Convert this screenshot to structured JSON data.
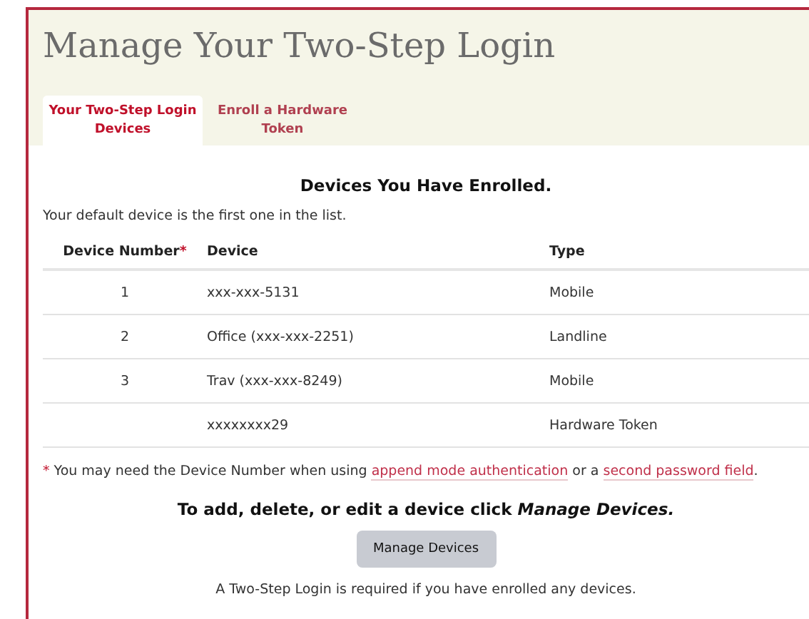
{
  "page": {
    "title": "Manage Your Two-Step Login"
  },
  "tabs": [
    {
      "label": "Your Two-Step Login Devices",
      "selected": true
    },
    {
      "label": "Enroll a Hardware Token",
      "selected": false
    }
  ],
  "heading": "Devices You Have Enrolled.",
  "intro": "Your default device is the first one in the list.",
  "table": {
    "columns": [
      {
        "label": "Device Number",
        "mark": "*"
      },
      {
        "label": "Device"
      },
      {
        "label": "Type"
      }
    ],
    "rows": [
      [
        "1",
        "xxx-xxx-5131",
        "Mobile"
      ],
      [
        "2",
        "Office (xxx-xxx-2251)",
        "Landline"
      ],
      [
        "3",
        "Trav (xxx-xxx-8249)",
        "Mobile"
      ],
      [
        "",
        "xxxxxxxx29",
        "Hardware Token"
      ]
    ]
  },
  "footnote": {
    "mark": "*",
    "parts": [
      {
        "kind": "text",
        "text": "You may need the Device Number when using "
      },
      {
        "kind": "link",
        "text": "append mode authentication"
      },
      {
        "kind": "text",
        "text": " or a "
      },
      {
        "kind": "link",
        "text": "second password field"
      },
      {
        "kind": "text",
        "text": "."
      }
    ]
  },
  "instruction": "To add, delete, or edit a device click *Manage Devices.*",
  "button": "Manage Devices",
  "note": "A Two-Step Login is required if you have enrolled any devices."
}
